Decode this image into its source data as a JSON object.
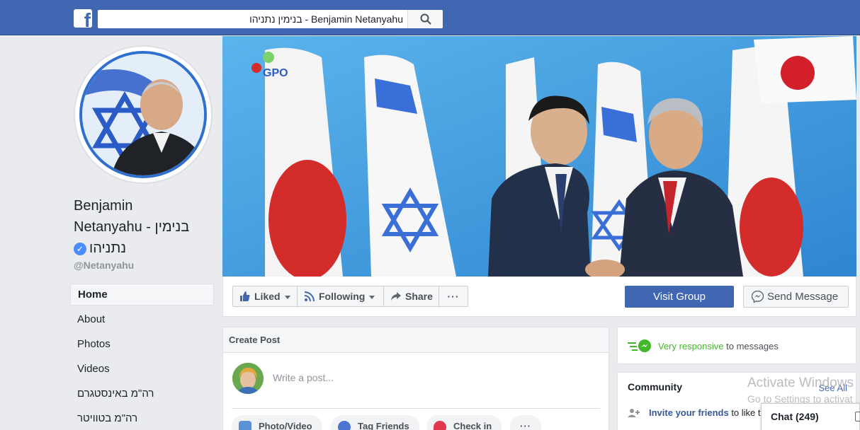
{
  "topbar": {
    "logo": "f",
    "search_value": "בנימין נתניהו - Benjamin Netanyahu",
    "search_icon": "search-icon",
    "colors": {
      "bar": "#4267b2"
    }
  },
  "profile": {
    "name_line1": "Benjamin",
    "name_line2": "Netanyahu - בנימין",
    "name_line3": "נתניהו",
    "handle": "@Netanyahu"
  },
  "nav": {
    "items": [
      {
        "label": "Home"
      },
      {
        "label": "About"
      },
      {
        "label": "Photos"
      },
      {
        "label": "Videos"
      },
      {
        "label": "רה\"מ באינסטגרם"
      },
      {
        "label": "רה\"מ בטוויטר"
      }
    ]
  },
  "cover": {
    "logo_text": "GPO"
  },
  "actions": {
    "liked": "Liked",
    "following": "Following",
    "share": "Share",
    "more": "···",
    "visit_group": "Visit Group",
    "send_message": "Send Message"
  },
  "create_post": {
    "title": "Create Post",
    "placeholder": "Write a post...",
    "buttons": {
      "photo_video": "Photo/Video",
      "tag_friends": "Tag Friends",
      "check_in": "Check in",
      "more": "···"
    }
  },
  "responsiveness": {
    "highlight": "Very responsive",
    "rest": " to messages"
  },
  "community": {
    "title": "Community",
    "see_all": "See All",
    "invite_link": "Invite your friends",
    "invite_rest": " to like t"
  },
  "watermark": {
    "line1": "Activate Windows",
    "line2": "Go to Settings to activat"
  },
  "chat": {
    "label": "Chat (249)"
  }
}
